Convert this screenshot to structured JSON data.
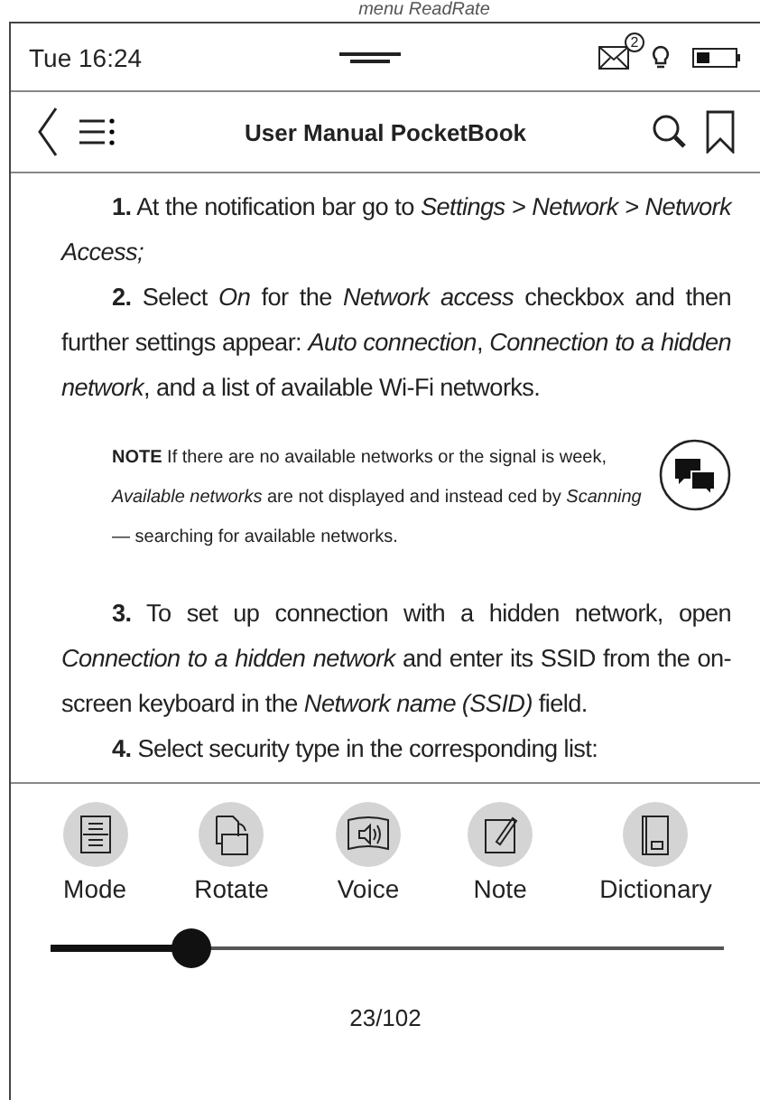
{
  "annotation": {
    "caption": "menu ReadRate"
  },
  "status_bar": {
    "time": "Tue 16:24",
    "mail_badge": "2"
  },
  "toolbar": {
    "title": "User Manual PocketBook"
  },
  "content": {
    "paragraphs": [
      {
        "kind": "step",
        "text": "**1.** At the notification bar go to *Settings > Network > Network Access;*"
      },
      {
        "kind": "step",
        "text": "**2.** Select *On* for the *Network access* checkbox and then further settings appear: *Auto connection*, *Connection to a hidden network*, and a list of available Wi-Fi networks."
      },
      {
        "kind": "note",
        "text": "**NOTE** If there are no available networks or the signal is week, *Available networks* are not displayed and instead ced by *Scanning* — searching for available networks."
      },
      {
        "kind": "step",
        "text": "**3.** To set up connection with a hidden network, open *Connection to a hidden network* and enter its SSID from the on-screen keyboard in the *Network name (SSID)* field."
      },
      {
        "kind": "step",
        "text": "**4.** Select security type in the corresponding list:"
      }
    ]
  },
  "menu": {
    "items": [
      {
        "kind": "mode",
        "label": "Mode"
      },
      {
        "kind": "rotate",
        "label": "Rotate"
      },
      {
        "kind": "voice",
        "label": "Voice"
      },
      {
        "kind": "note",
        "label": "Note"
      },
      {
        "kind": "dictionary",
        "label": "Dictionary"
      }
    ]
  },
  "slider": {
    "level": 0.21
  },
  "page": "23/102"
}
